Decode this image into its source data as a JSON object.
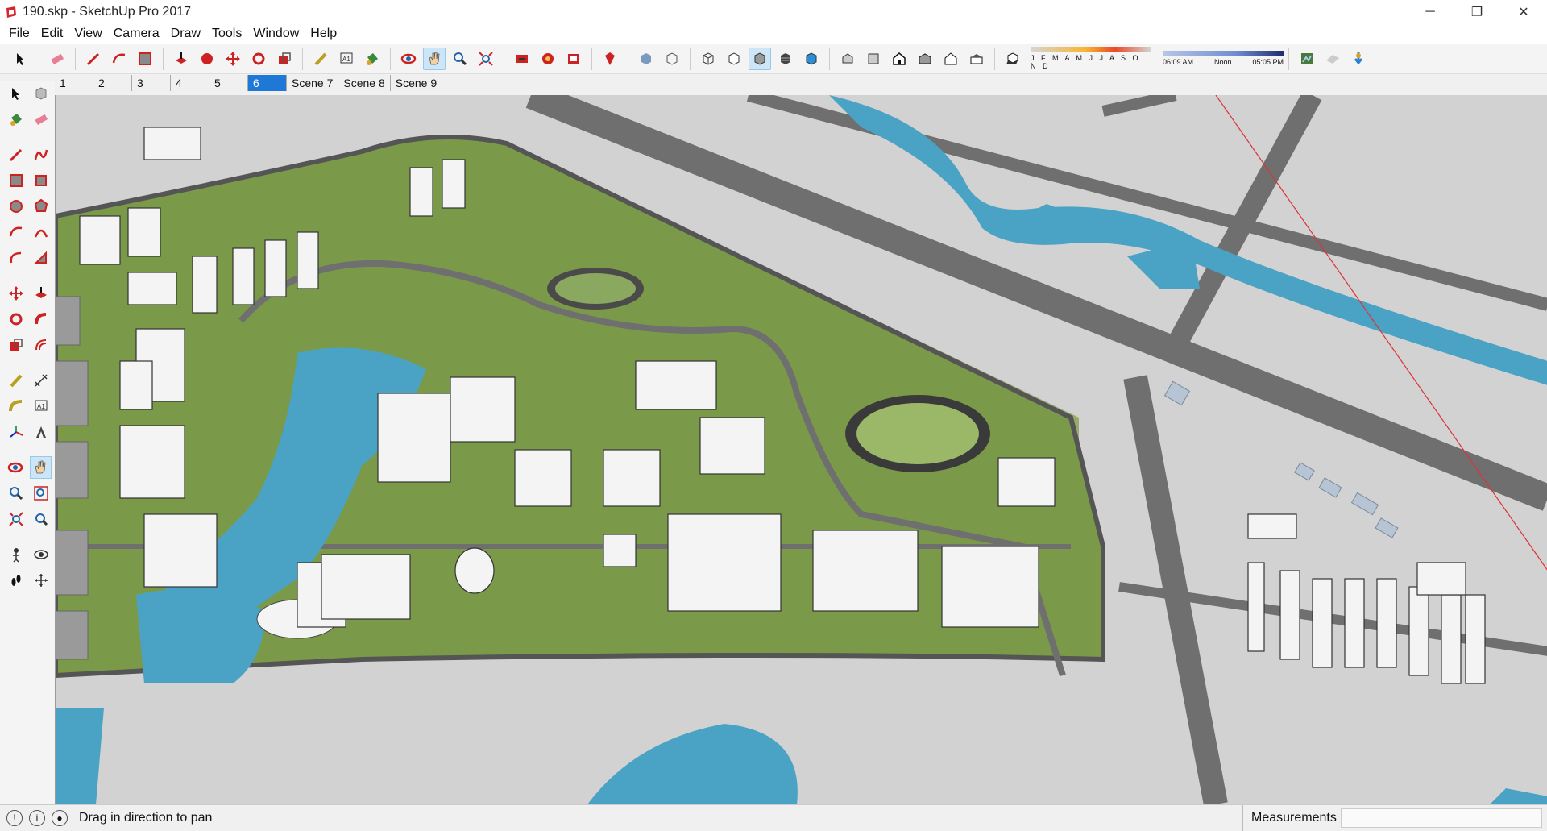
{
  "window": {
    "title": "190.skp - SketchUp Pro 2017",
    "controls": {
      "minimize": "─",
      "restore": "❐",
      "close": "✕"
    }
  },
  "menu": [
    "File",
    "Edit",
    "View",
    "Camera",
    "Draw",
    "Tools",
    "Window",
    "Help"
  ],
  "toolbar": {
    "months": "J F M A M J J A S O N D",
    "time_start": "06:09 AM",
    "time_mid": "Noon",
    "time_end": "05:05 PM"
  },
  "scenes": [
    "1",
    "2",
    "3",
    "4",
    "5",
    "6",
    "Scene 7",
    "Scene 8",
    "Scene 9"
  ],
  "active_scene": "6",
  "status": {
    "hint": "Drag in direction to pan",
    "measurements_label": "Measurements",
    "measurements_value": ""
  },
  "colors": {
    "water": "#4aa3c4",
    "grass": "#7a9a4a",
    "road": "#6f6f6f",
    "ground": "#d2d2d2",
    "building": "#f4f4f4",
    "selection": "#1e78d6"
  }
}
